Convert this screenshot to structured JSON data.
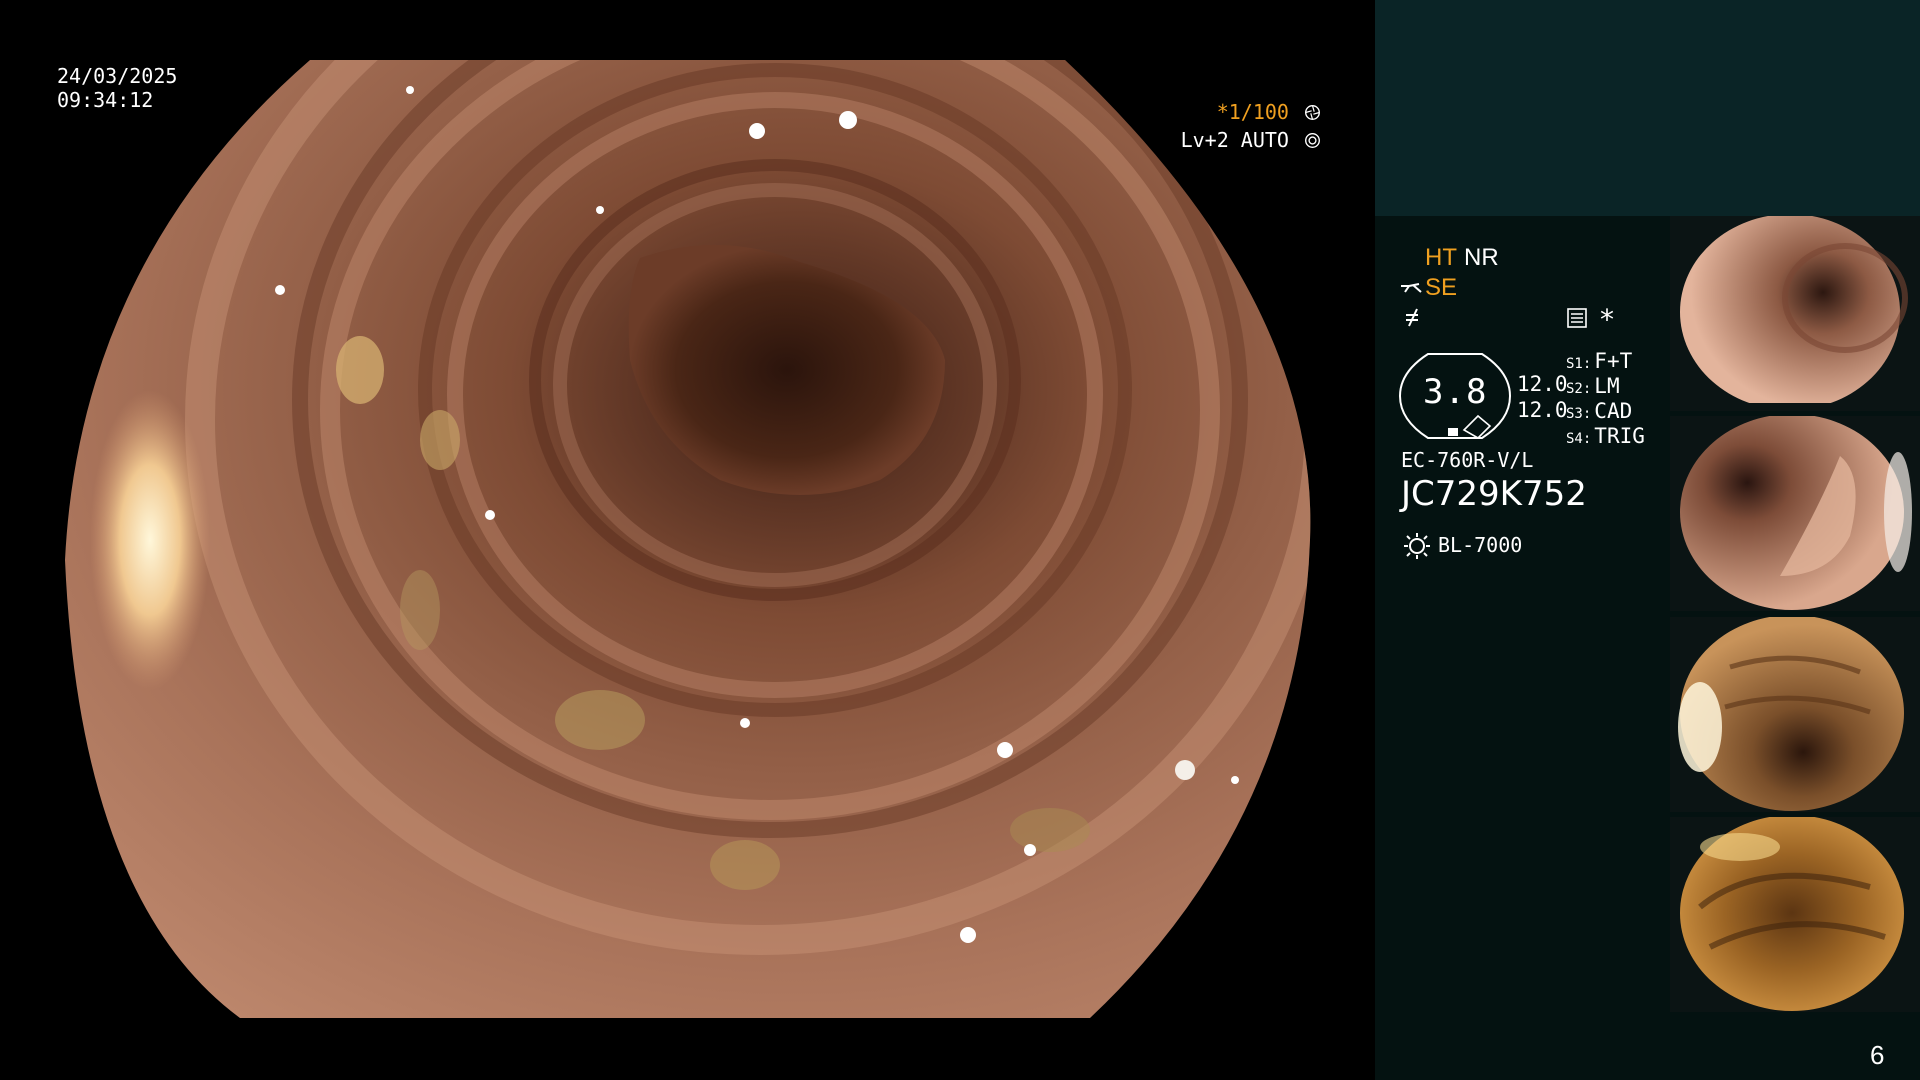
{
  "timestamp": {
    "date": "24/03/2025",
    "time": "09:34:12"
  },
  "osd": {
    "shutter": "*1/100",
    "shutter_icon": "aperture-icon",
    "level": "Lv+2 AUTO",
    "level_icon": "iris-icon"
  },
  "panel": {
    "ht": "HT",
    "nr": "NR",
    "se": "SE",
    "gauge_value": "3.8",
    "ratio_1": "12.0",
    "ratio_2": "12.0",
    "switches": [
      {
        "key": "S1:",
        "value": "F+T"
      },
      {
        "key": "S2:",
        "value": "LM"
      },
      {
        "key": "S3:",
        "value": "CAD"
      },
      {
        "key": "S4:",
        "value": "TRIG"
      }
    ],
    "asterisk": "*",
    "scope_model": "EC-760R-V/L",
    "serial": "JC729K752",
    "light_source": "BL-7000",
    "page_number": "6"
  },
  "colors": {
    "accent_orange": "#f0a020",
    "panel_bg": "#041211",
    "panel_top_bg": "#0a2426"
  },
  "thumbnails": [
    {
      "tone": "pink"
    },
    {
      "tone": "pink"
    },
    {
      "tone": "amber"
    },
    {
      "tone": "amber"
    }
  ]
}
